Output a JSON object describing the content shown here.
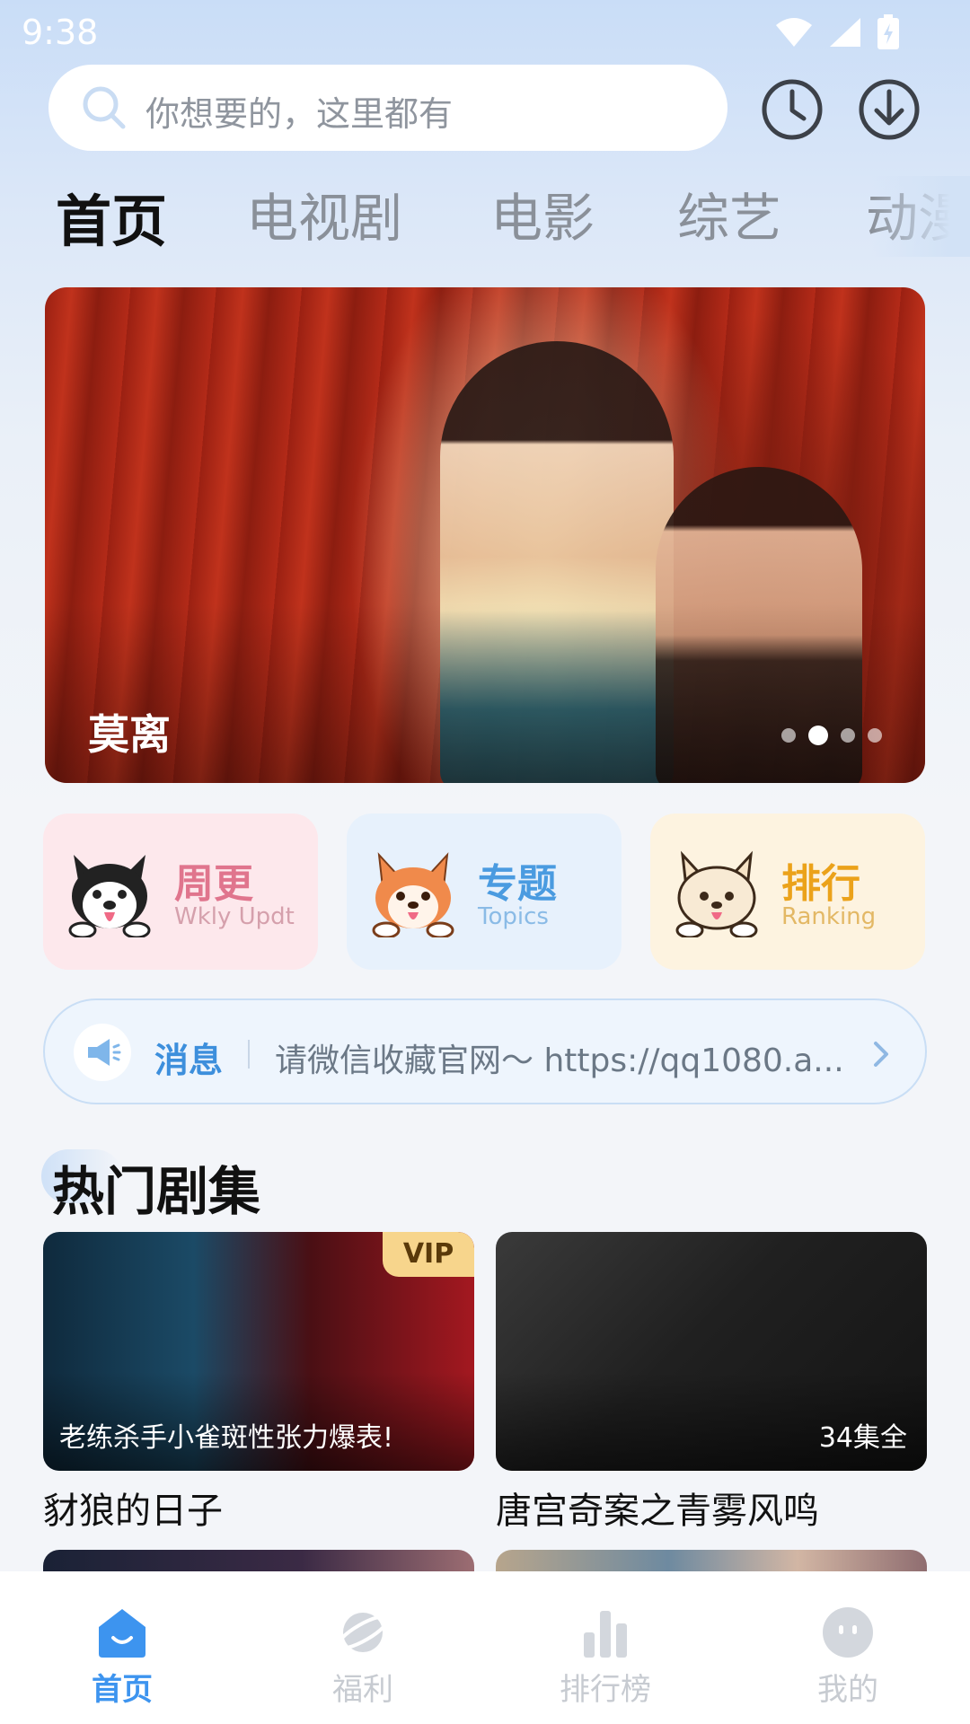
{
  "status_bar": {
    "time": "9:38"
  },
  "search": {
    "placeholder": "你想要的，这里都有"
  },
  "tabs": [
    {
      "label": "首页",
      "active": true
    },
    {
      "label": "电视剧",
      "active": false
    },
    {
      "label": "电影",
      "active": false
    },
    {
      "label": "综艺",
      "active": false
    },
    {
      "label": "动漫",
      "active": false
    }
  ],
  "banner": {
    "title": "莫离",
    "slide_count": 4,
    "active_slide": 2
  },
  "quick_entries": [
    {
      "title": "周更",
      "subtitle": "Wkly Updt",
      "icon": "husky-mascot-icon"
    },
    {
      "title": "专题",
      "subtitle": "Topics",
      "icon": "corgi-mascot-icon"
    },
    {
      "title": "排行",
      "subtitle": "Ranking",
      "icon": "shiba-mascot-icon"
    }
  ],
  "notice": {
    "label": "消息",
    "text": "请微信收藏官网～ https://qq1080.a..."
  },
  "section": {
    "title": "热门剧集"
  },
  "shows": [
    {
      "name": "豺狼的日子",
      "caption": "老练杀手小雀斑性张力爆表!",
      "badge": "VIP"
    },
    {
      "name": "唐宫奇案之青雾风鸣",
      "episode": "34集全"
    }
  ],
  "bottom_nav": [
    {
      "label": "首页",
      "active": true,
      "icon": "home-icon"
    },
    {
      "label": "福利",
      "active": false,
      "icon": "planet-icon"
    },
    {
      "label": "排行榜",
      "active": false,
      "icon": "bar-chart-icon"
    },
    {
      "label": "我的",
      "active": false,
      "icon": "profile-face-icon"
    }
  ],
  "colors": {
    "accent": "#3d94ef",
    "weekly": "#e0758d",
    "topics": "#4a9be0",
    "ranking": "#eba21a"
  }
}
